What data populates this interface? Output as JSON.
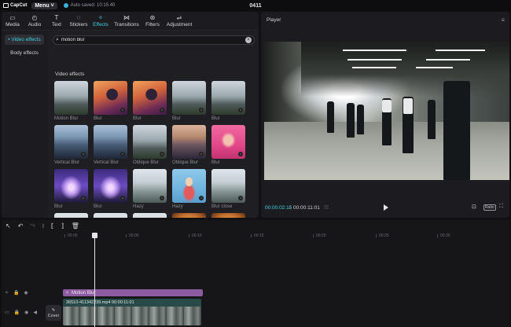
{
  "titlebar": {
    "logo_text": "CapCut",
    "menu_label": "Menu",
    "autosave": "Auto saved: 10:15:40",
    "project_title": "0411"
  },
  "tabs": [
    {
      "label": "Media",
      "icon": "media-icon"
    },
    {
      "label": "Audio",
      "icon": "audio-icon"
    },
    {
      "label": "Text",
      "icon": "text-icon"
    },
    {
      "label": "Stickers",
      "icon": "stickers-icon"
    },
    {
      "label": "Effects",
      "icon": "effects-icon"
    },
    {
      "label": "Transitions",
      "icon": "transitions-icon"
    },
    {
      "label": "Filters",
      "icon": "filters-icon"
    },
    {
      "label": "Adjustment",
      "icon": "adjustment-icon"
    }
  ],
  "sidebar": {
    "items": [
      {
        "label": "• Video effects"
      },
      {
        "label": "Body effects"
      }
    ]
  },
  "search": {
    "value": "motion blur",
    "placeholder": "Search"
  },
  "effects": {
    "section_title": "Video effects",
    "items": [
      {
        "label": "Motion Blur",
        "style": "t-motion",
        "download": false
      },
      {
        "label": "Blur",
        "style": "t-blur-orange",
        "download": true
      },
      {
        "label": "Blur",
        "style": "t-blur-orange",
        "download": true
      },
      {
        "label": "Blur",
        "style": "t-motion",
        "download": true
      },
      {
        "label": "Blur",
        "style": "t-motion",
        "download": true
      },
      {
        "label": "Vertical Blur",
        "style": "t-city",
        "download": true
      },
      {
        "label": "Vertical Blur",
        "style": "t-city",
        "download": true
      },
      {
        "label": "Oblique Blur",
        "style": "t-motion",
        "download": true
      },
      {
        "label": "Oblique Blur",
        "style": "t-city-orange",
        "download": true
      },
      {
        "label": "Blur",
        "style": "t-pink",
        "download": true
      },
      {
        "label": "Blur",
        "style": "t-purple",
        "download": true
      },
      {
        "label": "Blur",
        "style": "t-purple",
        "download": true
      },
      {
        "label": "Hazy",
        "style": "t-hazy",
        "download": true
      },
      {
        "label": "Hazy",
        "style": "t-kid",
        "download": true
      },
      {
        "label": "Blur close",
        "style": "t-hazy",
        "download": true
      },
      {
        "label": "",
        "style": "t-hazy",
        "download": false
      },
      {
        "label": "",
        "style": "t-hazy",
        "download": false
      },
      {
        "label": "",
        "style": "t-hazy",
        "download": false
      },
      {
        "label": "",
        "style": "t-tv",
        "download": false
      },
      {
        "label": "",
        "style": "t-tv",
        "download": false
      }
    ]
  },
  "player": {
    "title": "Player",
    "current_time": "00:00:02:15",
    "separator": "/",
    "duration": "00:00:11:01",
    "ratio_label": "Ratio"
  },
  "timeline": {
    "ticks": [
      "00:00",
      "00:05",
      "00:10",
      "00:15",
      "00:20",
      "00:25",
      "00:30"
    ],
    "effect_clip_label": "Motion Blur",
    "video_clip_label": "36510-411342239.mp4  00:00:11:01",
    "cover_label": "Cover"
  },
  "colors": {
    "accent": "#3ed3e0",
    "effect_clip": "#8d5b9f",
    "video_clip": "#2a4a4a"
  }
}
